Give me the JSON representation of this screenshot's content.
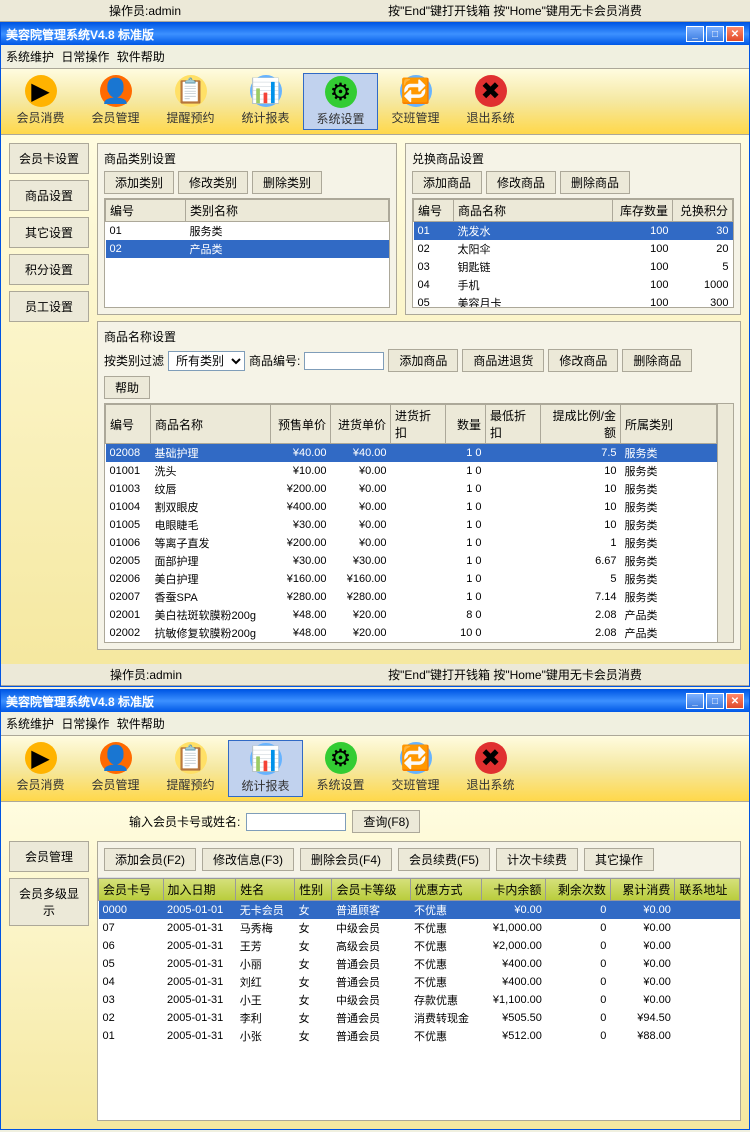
{
  "status_bar": {
    "operator_label": "操作员:admin",
    "hint": "按\"End\"键打开钱箱 按\"Home\"键用无卡会员消费"
  },
  "window1": {
    "title": "美容院管理系统V4.8 标准版",
    "menu": {
      "m1": "系统维护",
      "m2": "日常操作",
      "m3": "软件帮助"
    },
    "toolbar": {
      "t1": "会员消费",
      "t2": "会员管理",
      "t3": "提醒预约",
      "t4": "统计报表",
      "t5": "系统设置",
      "t6": "交班管理",
      "t7": "退出系统"
    },
    "sidebar": {
      "s1": "会员卡设置",
      "s2": "商品设置",
      "s3": "其它设置",
      "s4": "积分设置",
      "s5": "员工设置"
    },
    "category_panel": {
      "title": "商品类别设置",
      "btn_add": "添加类别",
      "btn_edit": "修改类别",
      "btn_del": "删除类别",
      "col_id": "编号",
      "col_name": "类别名称",
      "rows": [
        {
          "id": "01",
          "name": "服务类"
        },
        {
          "id": "02",
          "name": "产品类"
        }
      ]
    },
    "exchange_panel": {
      "title": "兑换商品设置",
      "btn_add": "添加商品",
      "btn_edit": "修改商品",
      "btn_del": "删除商品",
      "col_id": "编号",
      "col_name": "商品名称",
      "col_stock": "库存数量",
      "col_points": "兑换积分",
      "rows": [
        {
          "id": "01",
          "name": "洗发水",
          "stock": "100",
          "points": "30"
        },
        {
          "id": "02",
          "name": "太阳伞",
          "stock": "100",
          "points": "20"
        },
        {
          "id": "03",
          "name": "钥匙链",
          "stock": "100",
          "points": "5"
        },
        {
          "id": "04",
          "name": "手机",
          "stock": "100",
          "points": "1000"
        },
        {
          "id": "05",
          "name": "美容月卡",
          "stock": "100",
          "points": "300"
        }
      ]
    },
    "product_panel": {
      "title": "商品名称设置",
      "filter_label": "按类别过滤",
      "filter_value": "所有类别",
      "code_label": "商品编号:",
      "btn_add": "添加商品",
      "btn_return": "商品进退货",
      "btn_edit": "修改商品",
      "btn_del": "删除商品",
      "btn_help": "帮助",
      "cols": {
        "id": "编号",
        "name": "商品名称",
        "sale": "预售单价",
        "purchase": "进货单价",
        "discount": "进货折扣",
        "qty": "数量",
        "min_discount": "最低折扣",
        "commission": "提成比例/金额",
        "cat": "所属类别"
      },
      "rows": [
        {
          "id": "02008",
          "name": "基础护理",
          "sale": "¥40.00",
          "purchase": "¥40.00",
          "discount": "",
          "qty": "1 0",
          "min_discount": "",
          "commission": "7.5",
          "cat": "服务类",
          "sel": true
        },
        {
          "id": "01001",
          "name": "洗头",
          "sale": "¥10.00",
          "purchase": "¥0.00",
          "discount": "",
          "qty": "1 0",
          "min_discount": "",
          "commission": "10",
          "cat": "服务类"
        },
        {
          "id": "01003",
          "name": "纹唇",
          "sale": "¥200.00",
          "purchase": "¥0.00",
          "discount": "",
          "qty": "1 0",
          "min_discount": "",
          "commission": "10",
          "cat": "服务类"
        },
        {
          "id": "01004",
          "name": "割双眼皮",
          "sale": "¥400.00",
          "purchase": "¥0.00",
          "discount": "",
          "qty": "1 0",
          "min_discount": "",
          "commission": "10",
          "cat": "服务类"
        },
        {
          "id": "01005",
          "name": "电眼睫毛",
          "sale": "¥30.00",
          "purchase": "¥0.00",
          "discount": "",
          "qty": "1 0",
          "min_discount": "",
          "commission": "10",
          "cat": "服务类"
        },
        {
          "id": "01006",
          "name": "等离子直发",
          "sale": "¥200.00",
          "purchase": "¥0.00",
          "discount": "",
          "qty": "1 0",
          "min_discount": "",
          "commission": "1",
          "cat": "服务类"
        },
        {
          "id": "02005",
          "name": "面部护理",
          "sale": "¥30.00",
          "purchase": "¥30.00",
          "discount": "",
          "qty": "1 0",
          "min_discount": "",
          "commission": "6.67",
          "cat": "服务类"
        },
        {
          "id": "02006",
          "name": "美白护理",
          "sale": "¥160.00",
          "purchase": "¥160.00",
          "discount": "",
          "qty": "1 0",
          "min_discount": "",
          "commission": "5",
          "cat": "服务类"
        },
        {
          "id": "02007",
          "name": "香蚕SPA",
          "sale": "¥280.00",
          "purchase": "¥280.00",
          "discount": "",
          "qty": "1 0",
          "min_discount": "",
          "commission": "7.14",
          "cat": "服务类"
        },
        {
          "id": "02001",
          "name": "美白祛斑软膜粉200g",
          "sale": "¥48.00",
          "purchase": "¥20.00",
          "discount": "",
          "qty": "8 0",
          "min_discount": "",
          "commission": "2.08",
          "cat": "产品类"
        },
        {
          "id": "02002",
          "name": "抗敏修复软膜粉200g",
          "sale": "¥48.00",
          "purchase": "¥20.00",
          "discount": "",
          "qty": "10 0",
          "min_discount": "",
          "commission": "2.08",
          "cat": "产品类"
        }
      ]
    }
  },
  "window2": {
    "title": "美容院管理系统V4.8 标准版",
    "menu": {
      "m1": "系统维护",
      "m2": "日常操作",
      "m3": "软件帮助"
    },
    "toolbar": {
      "t1": "会员消费",
      "t2": "会员管理",
      "t3": "提醒预约",
      "t4": "统计报表",
      "t5": "系统设置",
      "t6": "交班管理",
      "t7": "退出系统"
    },
    "search_label": "输入会员卡号或姓名:",
    "search_btn": "查询(F8)",
    "sidebar": {
      "s1": "会员管理",
      "s2": "会员多级显示"
    },
    "actions": {
      "a1": "添加会员(F2)",
      "a2": "修改信息(F3)",
      "a3": "删除会员(F4)",
      "a4": "会员续费(F5)",
      "a5": "计次卡续费",
      "a6": "其它操作"
    },
    "cols": {
      "card": "会员卡号",
      "date": "加入日期",
      "name": "姓名",
      "gender": "性别",
      "level": "会员卡等级",
      "discount": "优惠方式",
      "balance": "卡内余额",
      "remain": "剩余次数",
      "total": "累计消费",
      "addr": "联系地址"
    },
    "rows": [
      {
        "card": "0000",
        "date": "2005-01-01",
        "name": "无卡会员",
        "gender": "女",
        "level": "普通顾客",
        "discount": "不优惠",
        "balance": "¥0.00",
        "remain": "0",
        "total": "¥0.00",
        "addr": "",
        "sel": true
      },
      {
        "card": "07",
        "date": "2005-01-31",
        "name": "马秀梅",
        "gender": "女",
        "level": "中级会员",
        "discount": "不优惠",
        "balance": "¥1,000.00",
        "remain": "0",
        "total": "¥0.00",
        "addr": ""
      },
      {
        "card": "06",
        "date": "2005-01-31",
        "name": "王芳",
        "gender": "女",
        "level": "高级会员",
        "discount": "不优惠",
        "balance": "¥2,000.00",
        "remain": "0",
        "total": "¥0.00",
        "addr": ""
      },
      {
        "card": "05",
        "date": "2005-01-31",
        "name": "小丽",
        "gender": "女",
        "level": "普通会员",
        "discount": "不优惠",
        "balance": "¥400.00",
        "remain": "0",
        "total": "¥0.00",
        "addr": ""
      },
      {
        "card": "04",
        "date": "2005-01-31",
        "name": "刘红",
        "gender": "女",
        "level": "普通会员",
        "discount": "不优惠",
        "balance": "¥400.00",
        "remain": "0",
        "total": "¥0.00",
        "addr": ""
      },
      {
        "card": "03",
        "date": "2005-01-31",
        "name": "小王",
        "gender": "女",
        "level": "中级会员",
        "discount": "存款优惠",
        "balance": "¥1,100.00",
        "remain": "0",
        "total": "¥0.00",
        "addr": ""
      },
      {
        "card": "02",
        "date": "2005-01-31",
        "name": "李利",
        "gender": "女",
        "level": "普通会员",
        "discount": "消费转现金",
        "balance": "¥505.50",
        "remain": "0",
        "total": "¥94.50",
        "addr": ""
      },
      {
        "card": "01",
        "date": "2005-01-31",
        "name": "小张",
        "gender": "女",
        "level": "普通会员",
        "discount": "不优惠",
        "balance": "¥512.00",
        "remain": "0",
        "total": "¥88.00",
        "addr": ""
      }
    ]
  }
}
